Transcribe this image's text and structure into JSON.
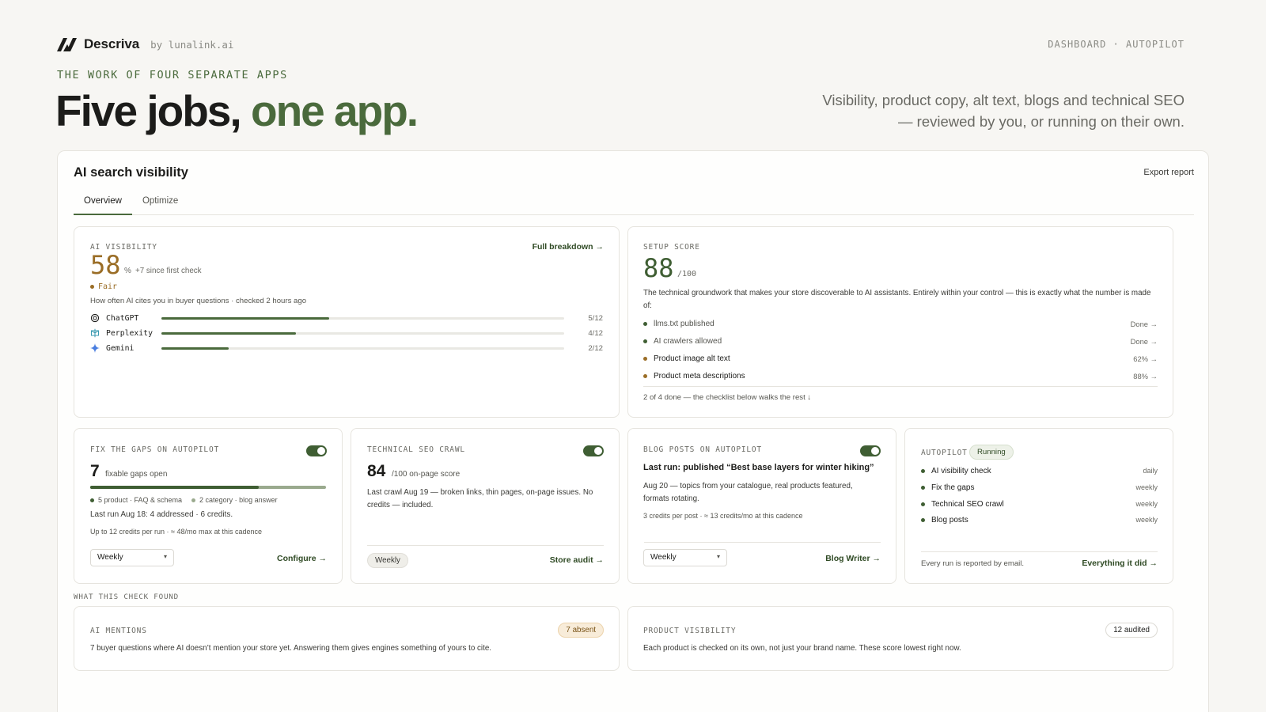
{
  "header": {
    "brand_name": "Descriva",
    "brand_by": "by lunalink.ai",
    "nav": "DASHBOARD · AUTOPILOT",
    "eyebrow": "THE WORK OF FOUR SEPARATE APPS",
    "headline_main": "Five jobs, ",
    "headline_accent": "one app.",
    "subhead": "Visibility, product copy, alt text, blogs and technical SEO — reviewed by you, or running on their own."
  },
  "panel": {
    "title": "AI search visibility",
    "export_label": "Export report",
    "tabs": [
      {
        "label": "Overview",
        "active": true
      },
      {
        "label": "Optimize",
        "active": false
      }
    ]
  },
  "visibility": {
    "label": "AI VISIBILITY",
    "link": "Full breakdown →",
    "score": "58",
    "unit": "%",
    "delta": "+7 since first check",
    "rating": "Fair",
    "description": "How often AI cites you in buyer questions · checked 2 hours ago",
    "engines": [
      {
        "name": "ChatGPT",
        "count": "5/12",
        "fraction": 0.4167,
        "icon": "chatgpt-icon"
      },
      {
        "name": "Perplexity",
        "count": "4/12",
        "fraction": 0.3333,
        "icon": "perplexity-icon"
      },
      {
        "name": "Gemini",
        "count": "2/12",
        "fraction": 0.1667,
        "icon": "gemini-icon"
      }
    ]
  },
  "setup": {
    "label": "SETUP SCORE",
    "score": "88",
    "of": "/100",
    "description": "The technical groundwork that makes your store discoverable to AI assistants. Entirely within your control — this is exactly what the number is made of:",
    "items": [
      {
        "text": "llms.txt published",
        "status": "Done →",
        "done": true
      },
      {
        "text": "AI crawlers allowed",
        "status": "Done →",
        "done": true
      },
      {
        "text": "Product image alt text",
        "status": "62% →",
        "done": false
      },
      {
        "text": "Product meta descriptions",
        "status": "88% →",
        "done": false
      }
    ],
    "footer": "2 of 4 done — the checklist below walks the rest ↓"
  },
  "gaps": {
    "label": "FIX THE GAPS ON AUTOPILOT",
    "count": "7",
    "unit": "fixable gaps open",
    "progress_fraction": 0.714,
    "legend": [
      "5 product · FAQ & schema",
      "2 category · blog answer"
    ],
    "last_run": "Last run Aug 18: 4 addressed · 6 credits.",
    "credits": "Up to 12 credits per run · ≈ 48/mo max at this cadence",
    "select_value": "Weekly",
    "link": "Configure →"
  },
  "seo": {
    "label": "TECHNICAL SEO CRAWL",
    "score": "84",
    "unit": "/100 on-page score",
    "description": "Last crawl Aug 19 — broken links, thin pages, on-page issues. No credits — included.",
    "badge": "Weekly",
    "link": "Store audit →"
  },
  "blog": {
    "label": "BLOG POSTS ON AUTOPILOT",
    "headline": "Last run: published “Best base layers for winter hiking”",
    "description": "Aug 20 — topics from your catalogue, real products featured, formats rotating.",
    "credits": "3 credits per post · ≈ 13 credits/mo at this cadence",
    "select_value": "Weekly",
    "link": "Blog Writer →"
  },
  "autopilot": {
    "label": "AUTOPILOT",
    "status": "Running",
    "items": [
      {
        "name": "AI visibility check",
        "freq": "daily"
      },
      {
        "name": "Fix the gaps",
        "freq": "weekly"
      },
      {
        "name": "Technical SEO crawl",
        "freq": "weekly"
      },
      {
        "name": "Blog posts",
        "freq": "weekly"
      }
    ],
    "footer": "Every run is reported by email.",
    "link": "Everything it did →"
  },
  "found": {
    "label": "WHAT THIS CHECK FOUND",
    "mentions": {
      "label": "AI MENTIONS",
      "badge": "7 absent",
      "text": "7 buyer questions where AI doesn’t mention your store yet. Answering them gives engines something of yours to cite."
    },
    "products": {
      "label": "PRODUCT VISIBILITY",
      "badge": "12 audited",
      "text": "Each product is checked on its own, not just your brand name. These score lowest right now."
    }
  },
  "colors": {
    "accent_green": "#4a6a3c",
    "amber": "#9a6d26",
    "background": "#f7f6f3"
  }
}
